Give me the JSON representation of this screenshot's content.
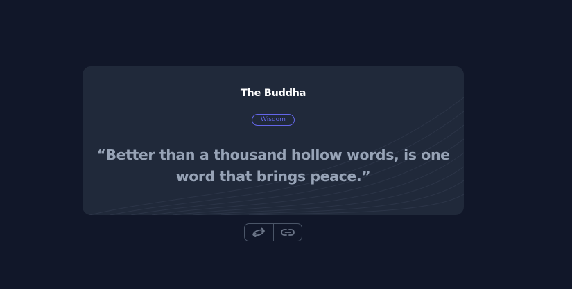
{
  "quote_card": {
    "author": "The Buddha",
    "tag": "Wisdom",
    "quote": "“Better than a thousand hollow words, is one word that brings peace.”"
  },
  "actions": {
    "random_icon": "shuffle-arrows-icon",
    "link_icon": "link-icon"
  },
  "colors": {
    "background": "#111729",
    "card": "#20293a",
    "accent": "#6466e9",
    "quote_text": "#97a3b6",
    "border": "#4a5567"
  }
}
